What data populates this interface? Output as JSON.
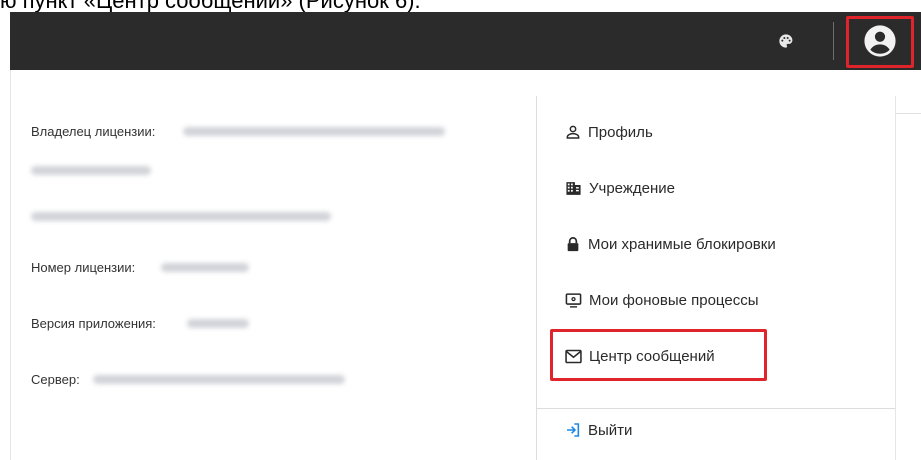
{
  "caption": {
    "text": "ю пункт «Центр сообщений» (Рисунок 6)."
  },
  "header": {
    "palette_icon": "palette-icon",
    "account_icon": "account-circle-icon",
    "highlight_color": "#e0242b",
    "bar_color": "#2b2b2b"
  },
  "info": {
    "license_owner_label": "Владелец лицензии:",
    "license_number_label": "Номер лицензии:",
    "app_version_label": "Версия приложения:",
    "server_label": "Сервер:"
  },
  "menu": {
    "items": [
      {
        "label": "Профиль",
        "icon": "person-icon"
      },
      {
        "label": "Учреждение",
        "icon": "building-icon"
      },
      {
        "label": "Мои хранимые блокировки",
        "icon": "lock-icon"
      },
      {
        "label": "Мои фоновые процессы",
        "icon": "monitor-icon"
      },
      {
        "label": "Центр сообщений",
        "icon": "mail-icon"
      },
      {
        "label": "Выйти",
        "icon": "logout-icon",
        "color": "#1e88e5"
      }
    ]
  }
}
